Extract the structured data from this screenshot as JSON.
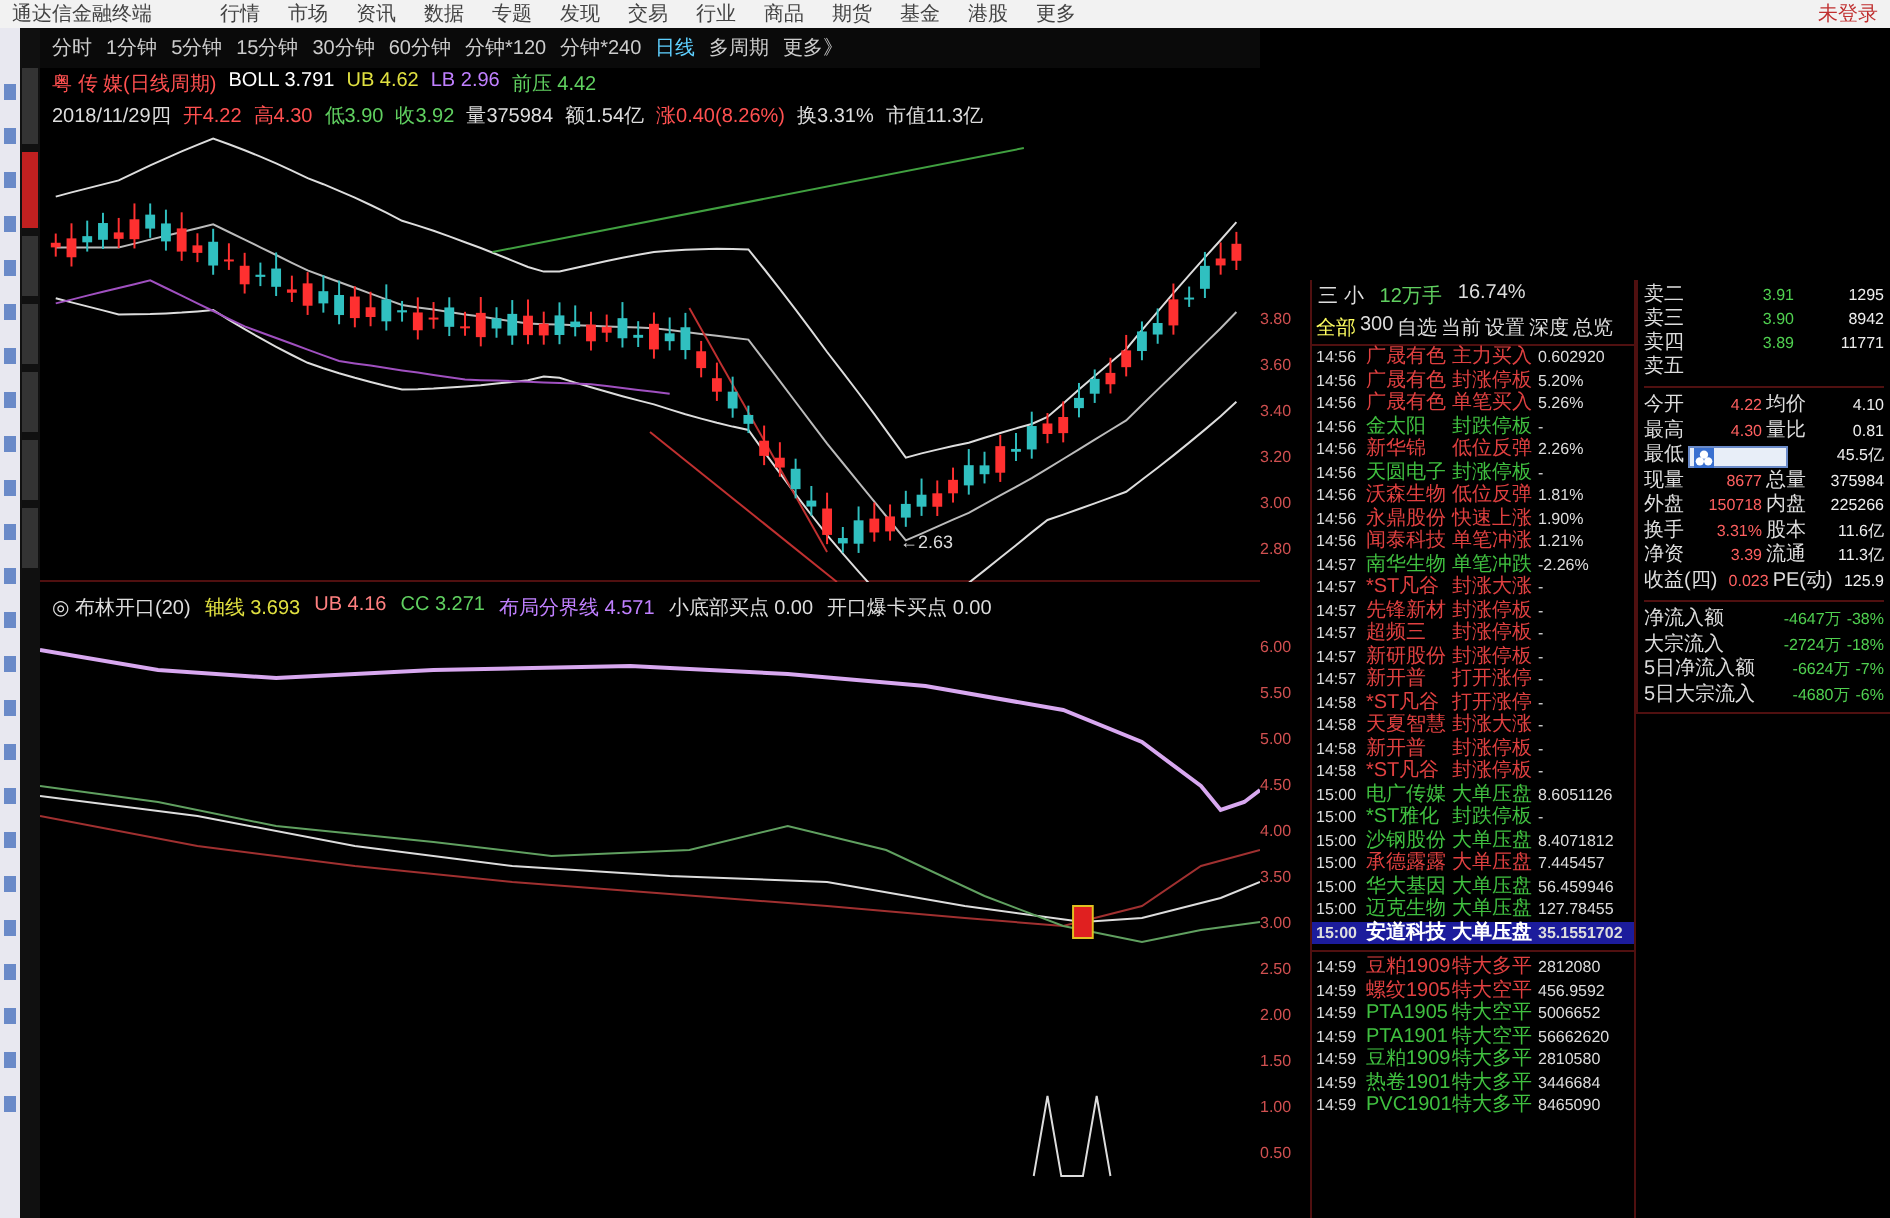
{
  "menu_bar": {
    "app_title": "通达信金融终端",
    "items": [
      "行情",
      "市场",
      "资讯",
      "数据",
      "专题",
      "发现",
      "交易",
      "行业",
      "商品",
      "期货",
      "基金",
      "港股",
      "更多"
    ],
    "login": "未登录"
  },
  "chart_toolbar": {
    "periods": [
      {
        "label": "分时",
        "selected": false
      },
      {
        "label": "1分钟",
        "selected": false
      },
      {
        "label": "5分钟",
        "selected": false
      },
      {
        "label": "15分钟",
        "selected": false
      },
      {
        "label": "30分钟",
        "selected": false
      },
      {
        "label": "60分钟",
        "selected": false
      },
      {
        "label": "分钟*120",
        "selected": false
      },
      {
        "label": "分钟*240",
        "selected": false
      },
      {
        "label": "日线",
        "selected": true
      },
      {
        "label": "多周期",
        "selected": false
      },
      {
        "label": "更多》",
        "selected": false
      }
    ]
  },
  "indicator_line": [
    "粤 传 媒(日线周期)",
    "BOLL 3.791",
    "UB 4.62",
    "LB 2.96",
    "前压 4.42"
  ],
  "info_line": [
    "2018/11/29四",
    "开4.22",
    "高4.30",
    "低3.90",
    "收3.92",
    "量375984",
    "额1.54亿",
    "涨0.40(8.26%)",
    "换3.31%",
    "市值11.3亿"
  ],
  "main_chart": {
    "low_marker": "←2.63"
  },
  "lower_panel": {
    "header": [
      "◎ 布林开口(20)",
      "轴线 3.693",
      "UB 4.16",
      "CC 3.271",
      "布局分界线 4.571",
      "小底部买点 0.00",
      "开口爆卡买点 0.00"
    ]
  },
  "price_axis": {
    "upper": [
      "3.80",
      "3.60",
      "3.40",
      "3.20",
      "3.00",
      "2.80"
    ],
    "lower": [
      "6.00",
      "5.50",
      "5.00",
      "4.50",
      "4.00",
      "3.50",
      "3.00",
      "2.50",
      "2.00",
      "1.50",
      "1.00",
      "0.50"
    ]
  },
  "ticker_panel": {
    "header": [
      "三 小",
      "12万手",
      "16.74%"
    ],
    "tabs": [
      {
        "label": "全部",
        "selected": true
      },
      {
        "label": "300",
        "selected": false
      },
      {
        "label": "自选",
        "selected": false
      },
      {
        "label": "当前",
        "selected": false
      },
      {
        "label": "设置",
        "selected": false
      },
      {
        "label": "深度",
        "selected": false
      },
      {
        "label": "总览",
        "selected": false
      }
    ],
    "rows": [
      {
        "time": "14:56",
        "name": "广晟有色",
        "signal": "主力买入",
        "value": "0.602920",
        "color": "#e04040",
        "selected": false
      },
      {
        "time": "14:56",
        "name": "广晟有色",
        "signal": "封涨停板",
        "value": "5.20%",
        "color": "#e04040",
        "selected": false
      },
      {
        "time": "14:56",
        "name": "广晟有色",
        "signal": "单笔买入",
        "value": "5.26%",
        "color": "#e04040",
        "selected": false
      },
      {
        "time": "14:56",
        "name": "金太阳",
        "signal": "封跌停板",
        "value": "-",
        "color": "#40c040",
        "selected": false
      },
      {
        "time": "14:56",
        "name": "新华锦",
        "signal": "低位反弹",
        "value": "2.26%",
        "color": "#e04040",
        "selected": false
      },
      {
        "time": "14:56",
        "name": "天圆电子",
        "signal": "封涨停板",
        "value": "-",
        "color": "#40c040",
        "selected": false
      },
      {
        "time": "14:56",
        "name": "沃森生物",
        "signal": "低位反弹",
        "value": "1.81%",
        "color": "#e04040",
        "selected": false
      },
      {
        "time": "14:56",
        "name": "永鼎股份",
        "signal": "快速上涨",
        "value": "1.90%",
        "color": "#e04040",
        "selected": false
      },
      {
        "time": "14:56",
        "name": "闻泰科技",
        "signal": "单笔冲涨",
        "value": "1.21%",
        "color": "#e04040",
        "selected": false
      },
      {
        "time": "14:57",
        "name": "南华生物",
        "signal": "单笔冲跌",
        "value": "-2.26%",
        "color": "#40c040",
        "selected": false
      },
      {
        "time": "14:57",
        "name": "*ST凡谷",
        "signal": "封涨大涨",
        "value": "-",
        "color": "#e04040",
        "selected": false
      },
      {
        "time": "14:57",
        "name": "先锋新材",
        "signal": "封涨停板",
        "value": "-",
        "color": "#e04040",
        "selected": false
      },
      {
        "time": "14:57",
        "name": "超频三",
        "signal": "封涨停板",
        "value": "-",
        "color": "#e04040",
        "selected": false
      },
      {
        "time": "14:57",
        "name": "新研股份",
        "signal": "封涨停板",
        "value": "-",
        "color": "#e04040",
        "selected": false
      },
      {
        "time": "14:57",
        "name": "新开普",
        "signal": "打开涨停",
        "value": "-",
        "color": "#e04040",
        "selected": false
      },
      {
        "time": "14:58",
        "name": "*ST凡谷",
        "signal": "打开涨停",
        "value": "-",
        "color": "#e04040",
        "selected": false
      },
      {
        "time": "14:58",
        "name": "天夏智慧",
        "signal": "封涨大涨",
        "value": "-",
        "color": "#e04040",
        "selected": false
      },
      {
        "time": "14:58",
        "name": "新开普",
        "signal": "封涨停板",
        "value": "-",
        "color": "#e04040",
        "selected": false
      },
      {
        "time": "14:58",
        "name": "*ST凡谷",
        "signal": "封涨停板",
        "value": "-",
        "color": "#e04040",
        "selected": false
      },
      {
        "time": "15:00",
        "name": "电广传媒",
        "signal": "大单压盘",
        "value": "8.6051126",
        "color": "#40c040",
        "selected": false
      },
      {
        "time": "15:00",
        "name": "*ST雅化",
        "signal": "封跌停板",
        "value": "-",
        "color": "#40c040",
        "selected": false
      },
      {
        "time": "15:00",
        "name": "沙钢股份",
        "signal": "大单压盘",
        "value": "8.4071812",
        "color": "#40c040",
        "selected": false
      },
      {
        "time": "15:00",
        "name": "承德露露",
        "signal": "大单压盘",
        "value": "7.445457",
        "color": "#e04040",
        "selected": false
      },
      {
        "time": "15:00",
        "name": "华大基因",
        "signal": "大单压盘",
        "value": "56.459946",
        "color": "#40c040",
        "selected": false
      },
      {
        "time": "15:00",
        "name": "迈克生物",
        "signal": "大单压盘",
        "value": "127.78455",
        "color": "#40c040",
        "selected": false
      },
      {
        "time": "15:00",
        "name": "安道科技",
        "signal": "大单压盘",
        "value": "35.1551702",
        "selected": true
      }
    ],
    "futures_rows": [
      {
        "time": "14:59",
        "name": "豆粕1909",
        "signal": "特大多平",
        "value": "2812080",
        "color": "#e04040",
        "selected": false
      },
      {
        "time": "14:59",
        "name": "螺纹1905",
        "signal": "特大空平",
        "value": "456.9592",
        "color": "#e04040",
        "selected": false
      },
      {
        "time": "14:59",
        "name": "PTA1905",
        "signal": "特大空平",
        "value": "5006652",
        "color": "#40c040",
        "selected": false
      },
      {
        "time": "14:59",
        "name": "PTA1901",
        "signal": "特大空平",
        "value": "56662620",
        "color": "#40c040",
        "selected": false
      },
      {
        "time": "14:59",
        "name": "豆粕1909",
        "signal": "特大多平",
        "value": "2810580",
        "color": "#40c040",
        "selected": false
      },
      {
        "time": "14:59",
        "name": "热卷1901",
        "signal": "特大多平",
        "value": "3446684",
        "color": "#40c040",
        "selected": false
      },
      {
        "time": "14:59",
        "name": "PVC1901",
        "signal": "特大多平",
        "value": "8465090",
        "color": "#40c040",
        "selected": false
      }
    ]
  },
  "quote_panel": {
    "asks": [
      {
        "label": "卖二",
        "price": "3.91",
        "volume": "1295"
      },
      {
        "label": "卖三",
        "price": "3.90",
        "volume": "8942"
      },
      {
        "label": "卖四",
        "price": "3.89",
        "volume": "11771"
      },
      {
        "label": "卖五"
      }
    ],
    "stats": [
      {
        "label": "今开",
        "value": "4.22",
        "label2": "均价",
        "value2": "4.10"
      },
      {
        "label": "最高",
        "value": "4.30",
        "label2": "量比",
        "value2": "0.81"
      },
      {
        "label": "最低",
        "value2": "45.5亿"
      },
      {
        "label": "现量",
        "value": "8677",
        "label2": "总量",
        "value2": "375984"
      },
      {
        "label": "外盘",
        "value": "150718",
        "label2": "内盘",
        "value2": "225266"
      },
      {
        "label": "换手",
        "value": "3.31%",
        "label2": "股本",
        "value2": "11.6亿"
      },
      {
        "label": "净资",
        "value": "3.39",
        "label2": "流通",
        "value2": "11.3亿"
      },
      {
        "label": "收益(四)",
        "value": "0.023",
        "label2": "PE(动)",
        "value2": "125.9"
      }
    ],
    "flows": [
      {
        "label": "净流入额",
        "amount": "-4647万",
        "percent": "-38%"
      },
      {
        "label": "大宗流入",
        "amount": "-2724万",
        "percent": "-18%"
      },
      {
        "label": "5日净流入额",
        "amount": "-6624万",
        "percent": "-7%"
      },
      {
        "label": "5日大宗流入",
        "amount": "-4680万",
        "percent": "-6%"
      }
    ]
  }
}
